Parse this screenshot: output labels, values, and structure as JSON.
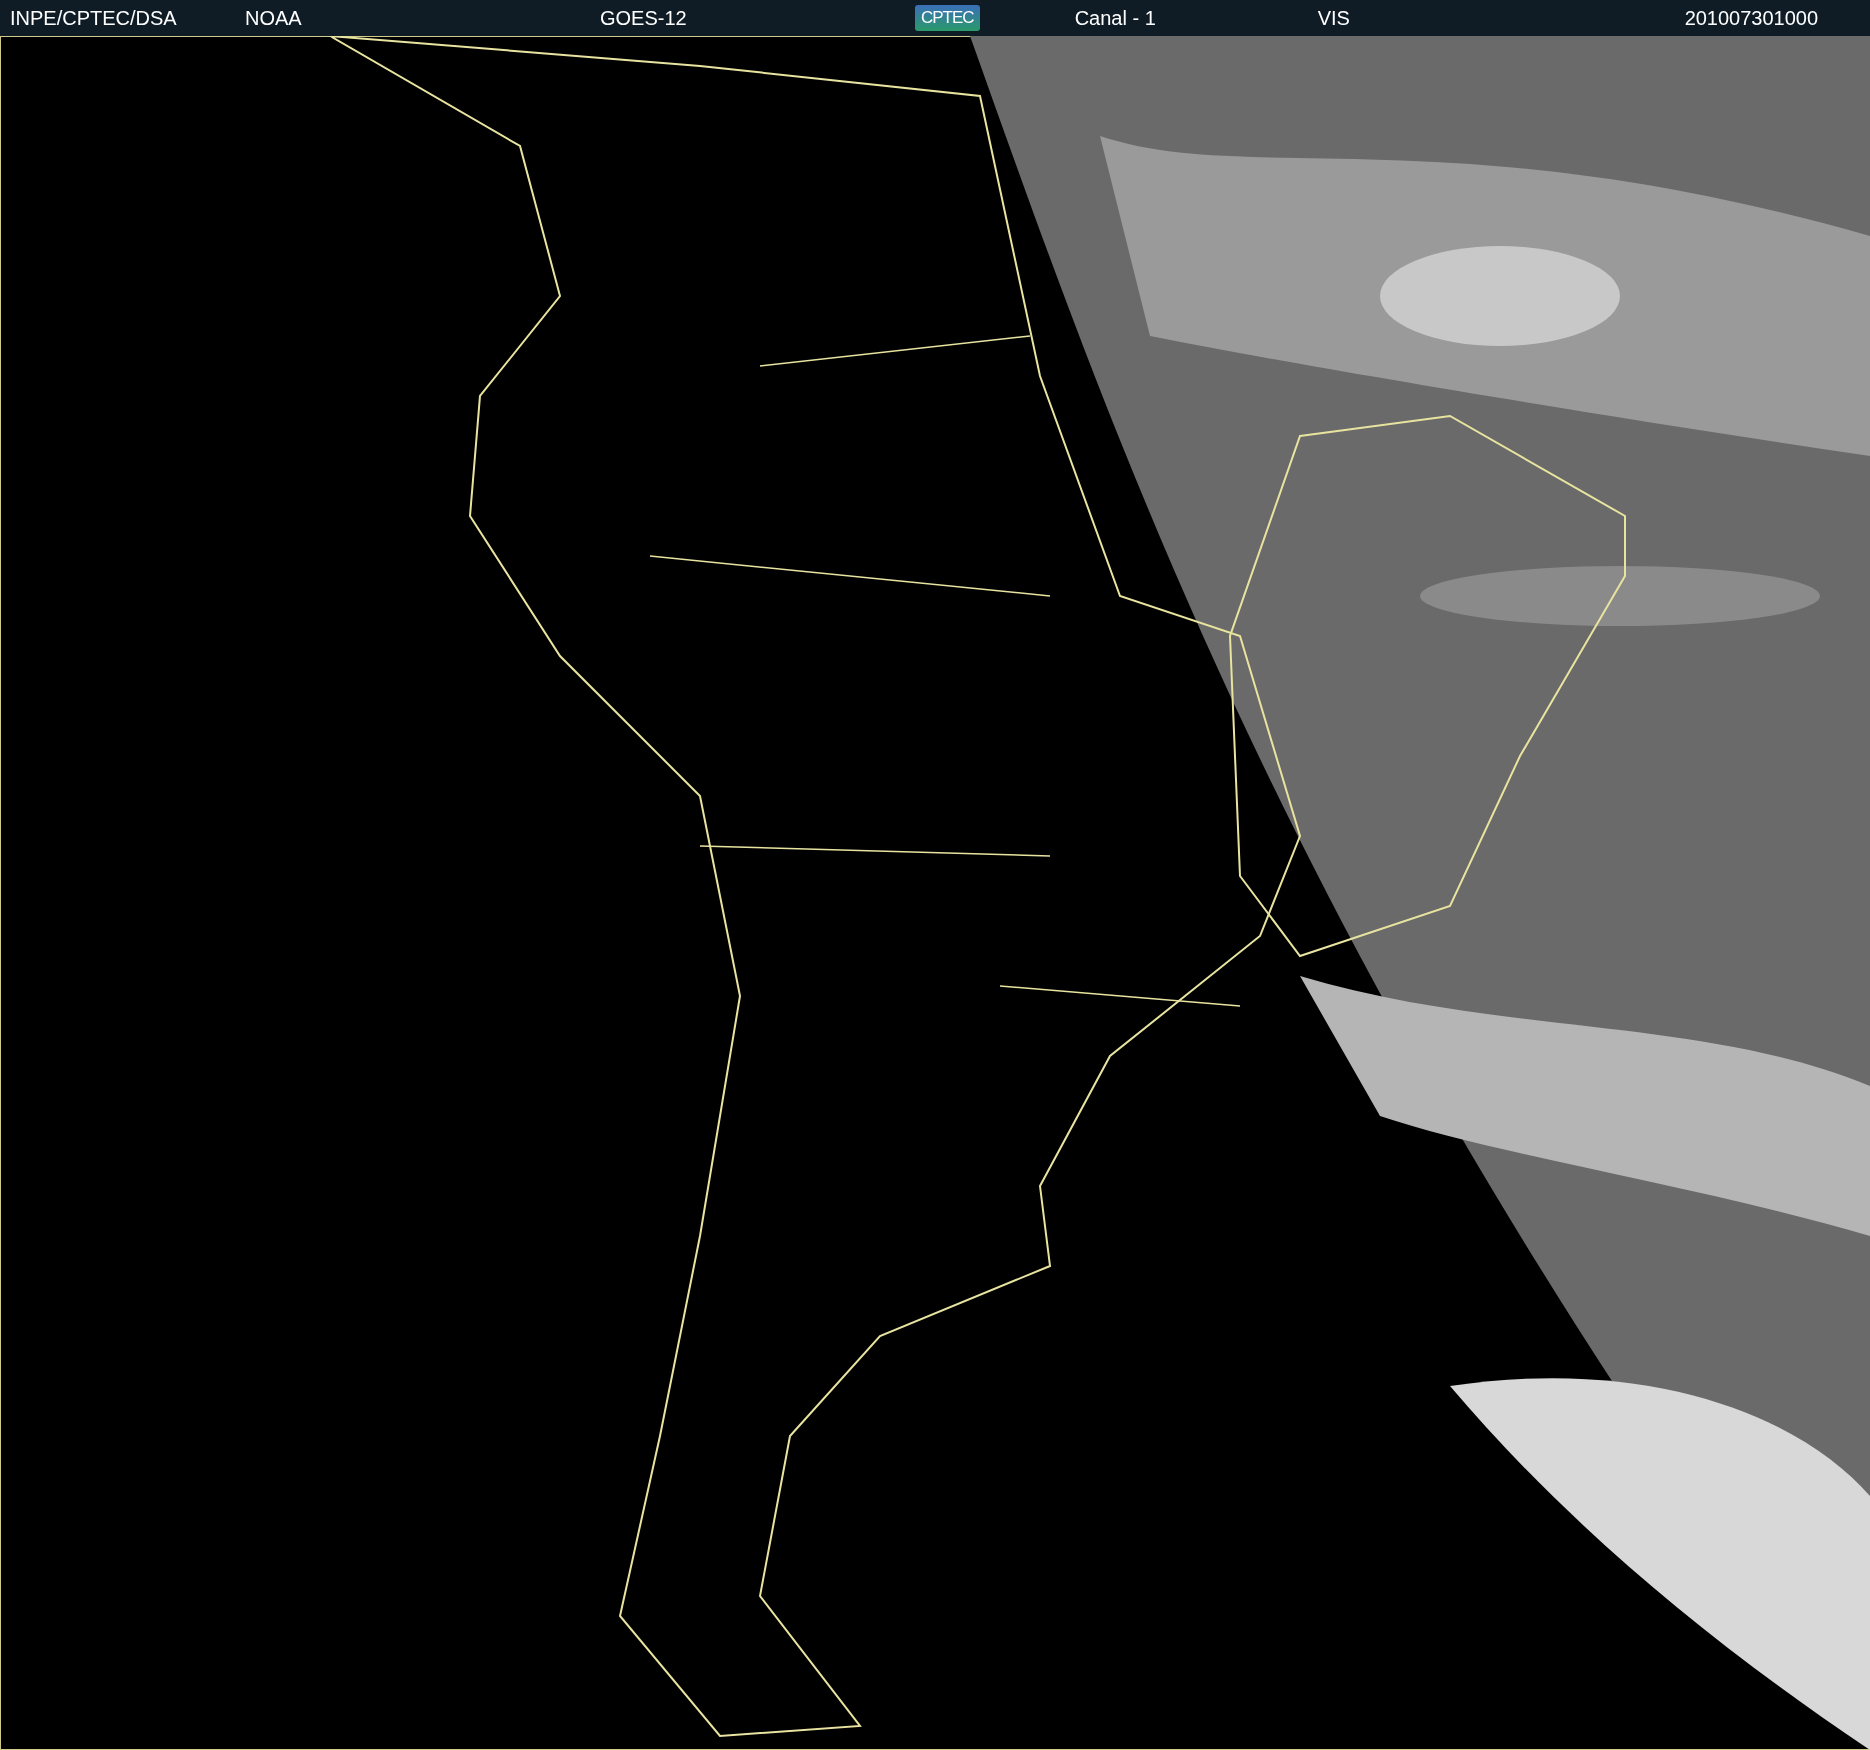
{
  "header": {
    "agency": "INPE/CPTEC/DSA",
    "source": "NOAA",
    "satellite": "GOES-12",
    "logo": "CPTEC",
    "channel": "Canal - 1",
    "band": "VIS",
    "timestamp": "201007301000"
  }
}
